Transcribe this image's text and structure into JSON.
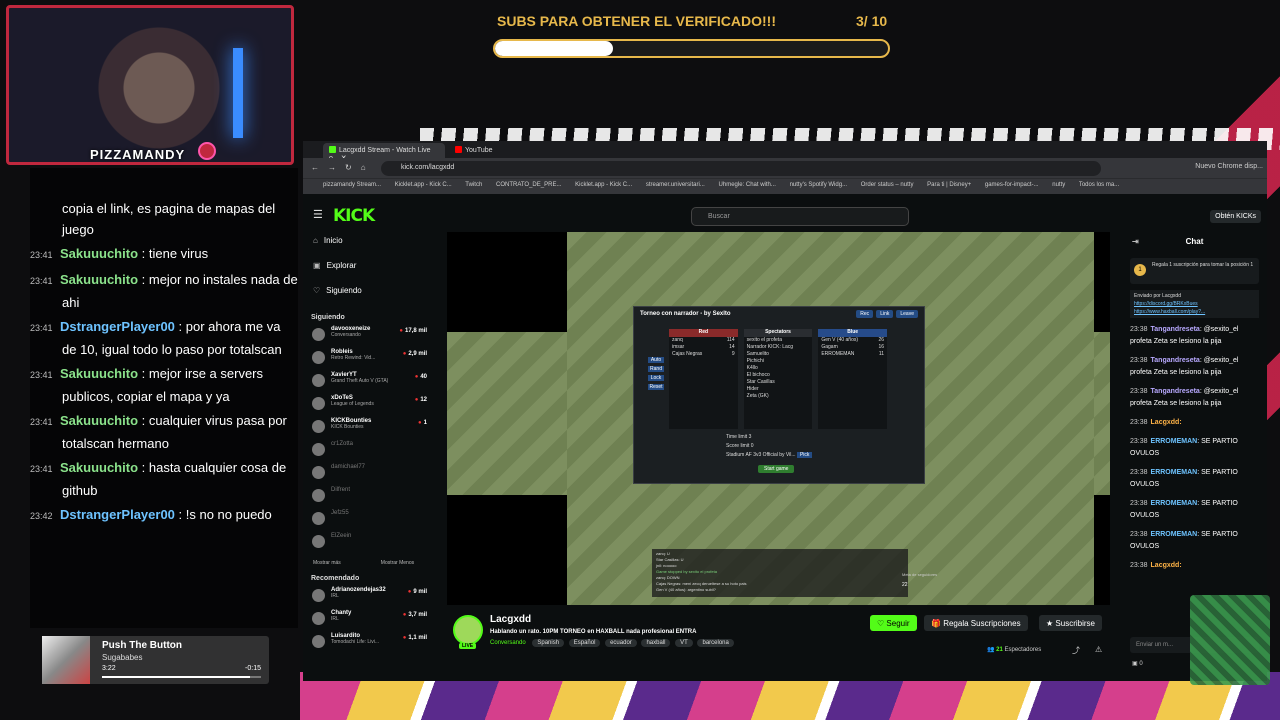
{
  "overlay": {
    "streamer_name": "PIZZAMANDY",
    "goal": {
      "title": "SUBS PARA OBTENER EL VERIFICADO!!!",
      "current_label": "3/ 10",
      "progress": 0.3
    },
    "chat": [
      {
        "time": "",
        "user": "",
        "text": "copia el link, es pagina de mapas del juego"
      },
      {
        "time": "23:41",
        "user": "Sakuuuchito",
        "text": ": tiene virus"
      },
      {
        "time": "23:41",
        "user": "Sakuuuchito",
        "text": ": mejor no instales nada de ahi"
      },
      {
        "time": "23:41",
        "user": "DstrangerPlayer00",
        "text": ": por ahora me va de 10, igual todo lo paso por totalscan"
      },
      {
        "time": "23:41",
        "user": "Sakuuuchito",
        "text": ": mejor irse a servers publicos, copiar el mapa y ya"
      },
      {
        "time": "23:41",
        "user": "Sakuuuchito",
        "text": ": cualquier virus pasa por totalscan hermano"
      },
      {
        "time": "23:41",
        "user": "Sakuuuchito",
        "text": ": hasta cualquier cosa de github"
      },
      {
        "time": "23:42",
        "user": "DstrangerPlayer00",
        "text": ": !s no no puedo"
      }
    ],
    "now_playing": {
      "title": "Push The Button",
      "artist": "Sugababes",
      "elapsed": "3:22",
      "remaining": "-0:15",
      "progress": 0.93
    }
  },
  "browser": {
    "tabs": [
      {
        "label": "Lacgxdd Stream - Watch Live o...",
        "active": true
      },
      {
        "label": "YouTube",
        "active": false
      }
    ],
    "url": "kick.com/lacgxdd",
    "chrome_note": "Nuevo Chrome disp...",
    "bookmarks": [
      "pizzamandy Stream...",
      "Kicklet.app - Kick C...",
      "Twitch",
      "CONTRATO_DE_PRE...",
      "Kicklet.app - Kick C...",
      "streamer.universitari...",
      "Uhmegle: Chat with...",
      "nutty's Spotify Widg...",
      "Order status – nutty",
      "Para ti | Disney+",
      "games-for-impact-...",
      "nutty",
      "Todos los ma..."
    ]
  },
  "kick": {
    "logo": "KICK",
    "search_placeholder": "Buscar",
    "kicks_button": "Obtén KICKs",
    "nav": [
      "Inicio",
      "Explorar",
      "Siguiendo"
    ],
    "following_header": "Siguiendo",
    "following": [
      {
        "name": "davooxeneize",
        "category": "Conversando",
        "viewers": "17,8 mil",
        "online": true
      },
      {
        "name": "Robleis",
        "category": "Retro Rewind: Vid...",
        "viewers": "2,9 mil",
        "online": true
      },
      {
        "name": "XavierYT",
        "category": "Grand Theft Auto V (GTA)",
        "viewers": "40",
        "online": true
      },
      {
        "name": "xDoTeS",
        "category": "League of Legends",
        "viewers": "12",
        "online": true
      },
      {
        "name": "KICKBounties",
        "category": "KICK Bounties",
        "viewers": "1",
        "online": true
      },
      {
        "name": "cr1Zotta",
        "category": "",
        "viewers": "",
        "online": false
      },
      {
        "name": "damichael77",
        "category": "",
        "viewers": "",
        "online": false
      },
      {
        "name": "Dilfrent",
        "category": "",
        "viewers": "",
        "online": false
      },
      {
        "name": "Jefz55",
        "category": "",
        "viewers": "",
        "online": false
      },
      {
        "name": "ElZeein",
        "category": "",
        "viewers": "",
        "online": false
      }
    ],
    "show_more": "Mostrar más",
    "show_less": "Mostrar Menos",
    "recommended_header": "Recomendado",
    "recommended": [
      {
        "name": "Adrianozendejas32",
        "category": "IRL",
        "viewers": "9 mil"
      },
      {
        "name": "Chanty",
        "category": "IRL",
        "viewers": "3,7 mil"
      },
      {
        "name": "Luisardito",
        "category": "Tomodachi Life: Livi...",
        "viewers": "1,1 mil"
      }
    ],
    "haxball": {
      "room_title": "Torneo con narrador - by Sexlto",
      "buttons": [
        "Rec",
        "Link",
        "Leave"
      ],
      "side_buttons": [
        "Auto",
        "Rand",
        "Lock",
        "Reset"
      ],
      "red_header": "Red",
      "spec_header": "Spectators",
      "blue_header": "Blue",
      "red": [
        "zanq",
        "imsar",
        "Cajas Negras"
      ],
      "red_pts": [
        "114",
        "14",
        "9"
      ],
      "spec": [
        "sexito el profeta",
        "Narrador KICK: Lacg",
        "Samuelito",
        "Pichichi",
        "K4llo",
        "El bichoco",
        "Star Casillas",
        "Hider",
        "Zeta (GK)"
      ],
      "blue": [
        "Gen V (40 años)",
        "Gagam",
        "ERROMEMAN"
      ],
      "blue_pts": [
        "26",
        "16",
        "11"
      ],
      "settings": [
        "Time limit  3",
        "Score limit  0",
        "Stadium  AF 3v3 Official by Vil..."
      ],
      "pick_label": "Pick",
      "start_label": "Start game",
      "chat_lines": [
        "zanq: U",
        "Star Casillas: U",
        "jnil: nooooo",
        "Game stopped by sexito el profeta",
        "zanq: DOWN",
        "Cajas Negras: meni zecq derueltese a su hoto pais",
        "Gen V (40 años): argentino subil?"
      ],
      "min_viewers": "Meta de seguidores",
      "min_viewers_value": "22"
    },
    "stream": {
      "channel": "Lacgxdd",
      "live_badge": "LIVE",
      "title": "Hablando un rato. 10PM TORNEO en HAXBALL nada profesional ENTRA",
      "category": "Conversando",
      "tags": [
        "Spanish",
        "Español",
        "ecuador",
        "haxball",
        "VT",
        "barcelona"
      ],
      "follow_label": "Seguir",
      "gift_label": "Regala Suscripciones",
      "subscribe_label": "Suscribirse",
      "viewers": "21",
      "viewers_label": "Espectadores"
    },
    "chat": {
      "header": "Chat",
      "gift_banner": "Regala 1 suscripción para tomar la posición 1",
      "pinned_by": "Enviado por  Lacgxdd",
      "pinned_links": [
        "https://discord.gg/BRKxBues",
        "https://www.haxball.com/play?..."
      ],
      "messages": [
        {
          "time": "23:38",
          "user": "Tangandreseta",
          "text": ": @sexito_el profeta Zeta se lesiono la pija",
          "color": "p"
        },
        {
          "time": "23:38",
          "user": "Tangandreseta",
          "text": ": @sexito_el profeta Zeta se lesiono la pija",
          "color": "p"
        },
        {
          "time": "23:38",
          "user": "Tangandreseta",
          "text": ": @sexito_el profeta Zeta se lesiono la pija",
          "color": "p"
        },
        {
          "time": "23:38",
          "user": "Lacgxdd:",
          "text": "",
          "color": "o"
        },
        {
          "time": "23:38",
          "user": "ERROMEMAN",
          "text": ": SE PARTIO OVULOS",
          "color": "b"
        },
        {
          "time": "23:38",
          "user": "ERROMEMAN",
          "text": ": SE PARTIO OVULOS",
          "color": "b"
        },
        {
          "time": "23:38",
          "user": "ERROMEMAN",
          "text": ": SE PARTIO OVULOS",
          "color": "b"
        },
        {
          "time": "23:38",
          "user": "ERROMEMAN",
          "text": ": SE PARTIO OVULOS",
          "color": "b"
        },
        {
          "time": "23:38",
          "user": "Lacgxdd:",
          "text": "",
          "color": "o"
        }
      ],
      "input_placeholder": "Enviar un m...",
      "kicks_count": "0"
    }
  }
}
